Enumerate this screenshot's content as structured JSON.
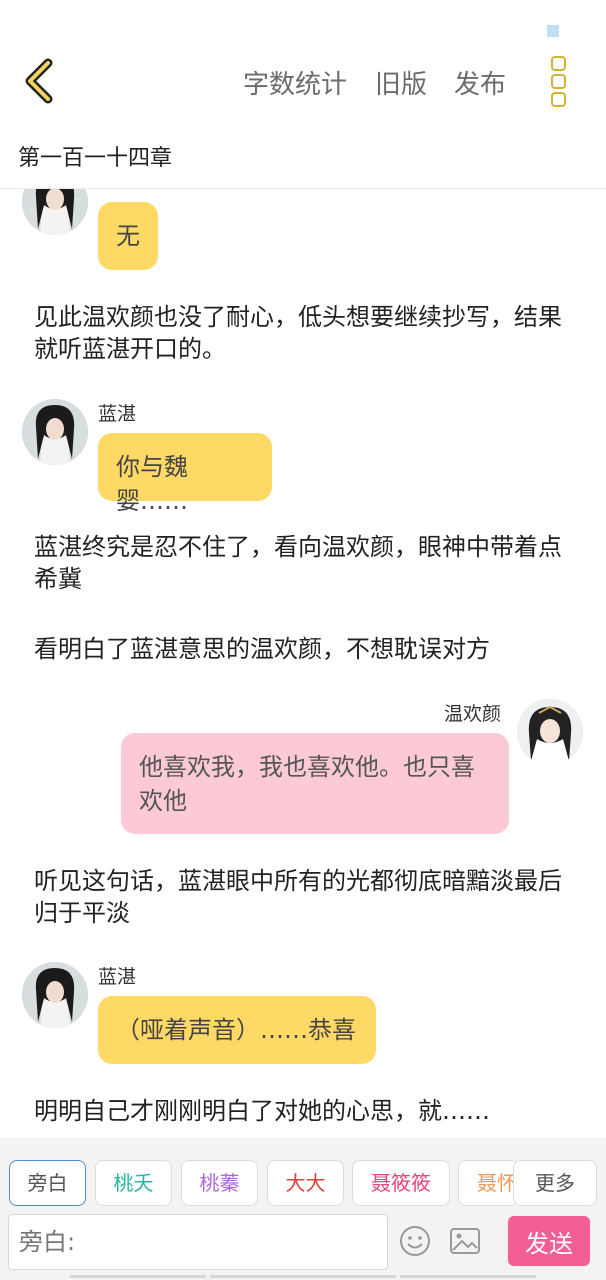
{
  "topbar": {
    "word_count_label": "字数统计",
    "old_version_label": "旧版",
    "publish_label": "发布"
  },
  "chapter": {
    "title": "第一百一十四章"
  },
  "colors": {
    "bubble_left": "#ffd966",
    "bubble_right": "#fbcad6",
    "send_button": "#f25e96",
    "accent_icon": "#d4b235"
  },
  "feed": {
    "msg1": {
      "text": "无"
    },
    "narr1": "见此温欢颜也没了耐心，低头想要继续抄写，结果就听蓝湛开口的。",
    "msg2": {
      "speaker": "蓝湛",
      "text": "你与魏婴……"
    },
    "narr2": "蓝湛终究是忍不住了，看向温欢颜，眼神中带着点希冀",
    "narr3": "看明白了蓝湛意思的温欢颜，不想耽误对方",
    "msg3": {
      "speaker": "温欢颜",
      "text": "他喜欢我，我也喜欢他。也只喜欢他"
    },
    "narr4": "听见这句话，蓝湛眼中所有的光都彻底暗黯淡最后归于平淡",
    "msg4": {
      "speaker": "蓝湛",
      "text": "（哑着声音）……恭喜"
    },
    "narr5": "明明自己才刚刚明白了对她的心思，就……"
  },
  "bottom": {
    "roles": [
      {
        "label": "旁白",
        "color": "#555555"
      },
      {
        "label": "桃夭",
        "color": "#2cb5a0"
      },
      {
        "label": "桃蓁",
        "color": "#b066d9"
      },
      {
        "label": "大大",
        "color": "#e0413a"
      },
      {
        "label": "聂筱筱",
        "color": "#e8437c"
      },
      {
        "label": "聂怀",
        "color": "#ef9a5a"
      }
    ],
    "more_label": "更多",
    "input_placeholder": "旁白:",
    "send_label": "发送"
  }
}
